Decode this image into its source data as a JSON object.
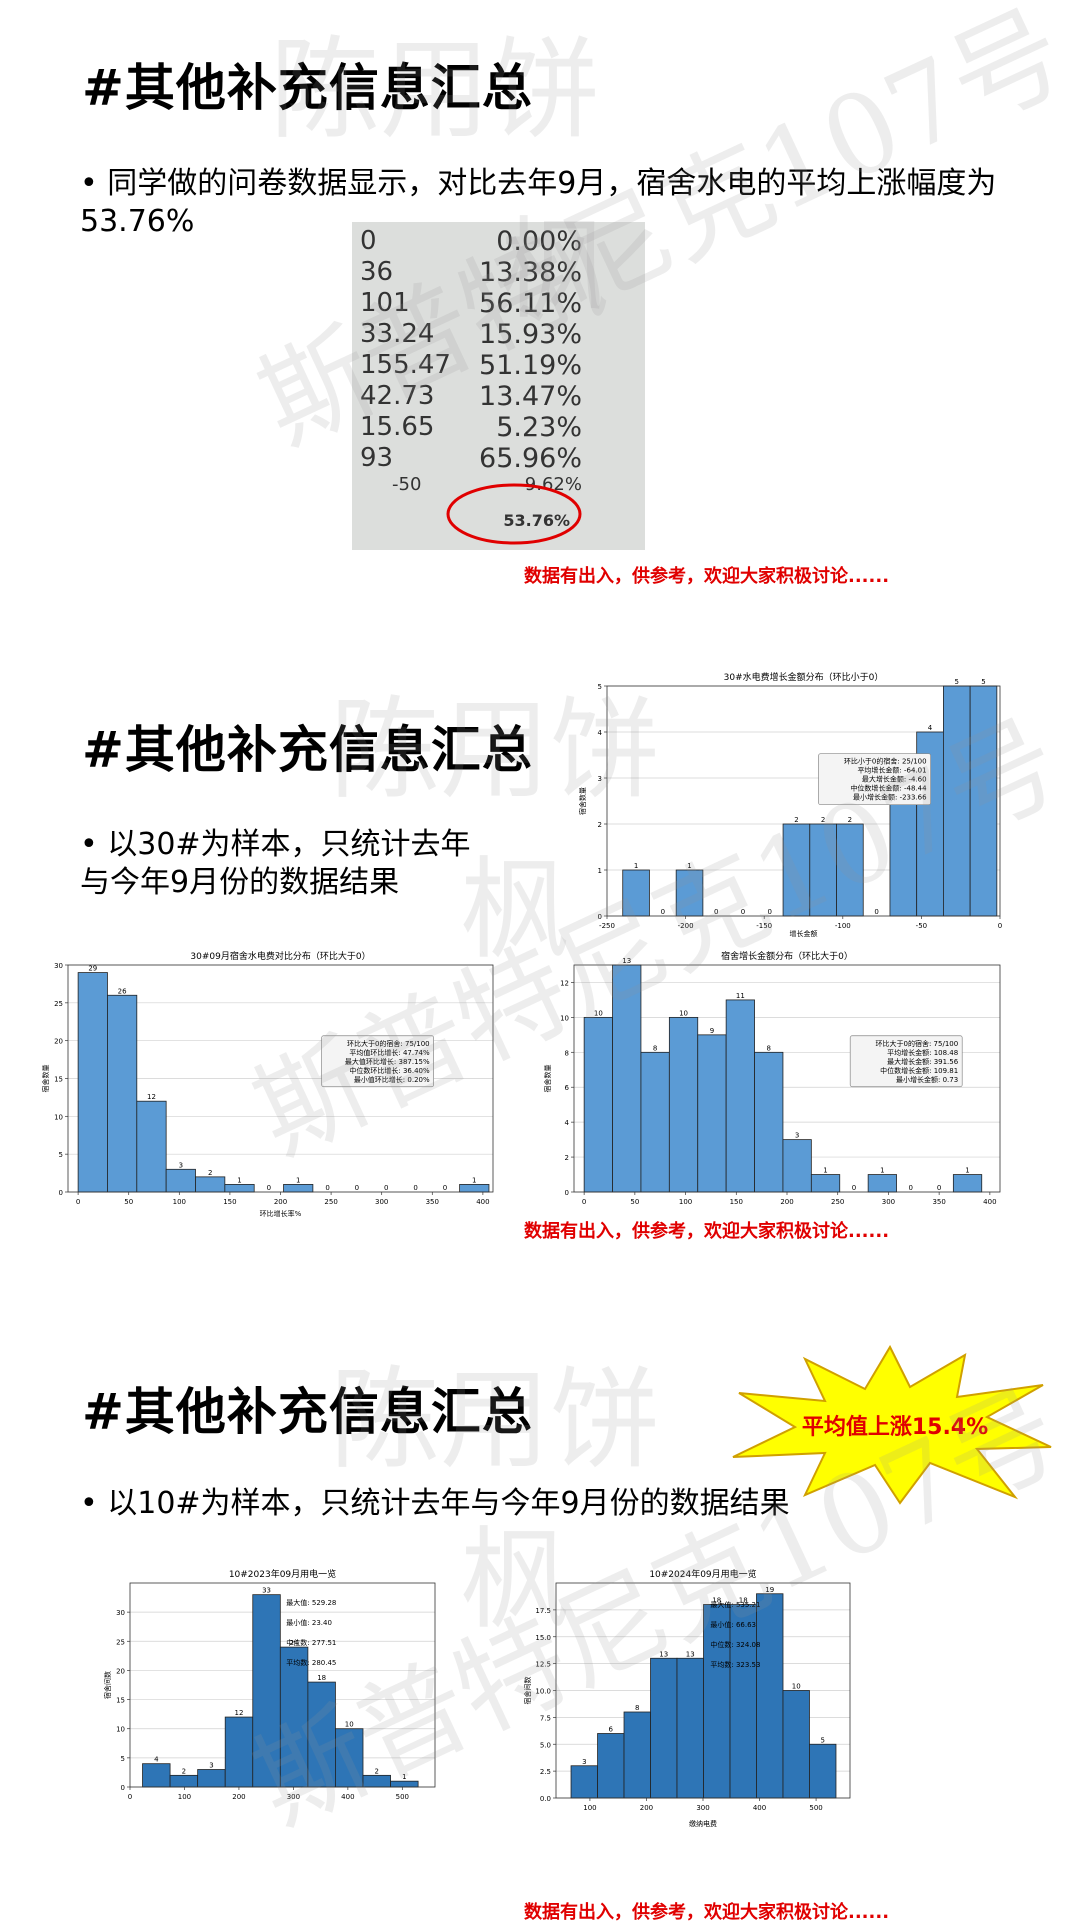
{
  "watermark": {
    "line1": "陈用饼",
    "line2": "枫",
    "line3": "斯普特尼克107号"
  },
  "section1": {
    "title": "#其他补充信息汇总",
    "bullet": "同学做的问卷数据显示，对比去年9月，宿舍水电的平均上涨幅度为53.76%",
    "table_rows": [
      {
        "a": "0",
        "b": "0.00%"
      },
      {
        "a": "36",
        "b": "13.38%"
      },
      {
        "a": "101",
        "b": "56.11%"
      },
      {
        "a": "33.24",
        "b": "15.93%"
      },
      {
        "a": "155.47",
        "b": "51.19%"
      },
      {
        "a": "42.73",
        "b": "13.47%"
      },
      {
        "a": "15.65",
        "b": "5.23%"
      },
      {
        "a": "93",
        "b": "65.96%"
      },
      {
        "a": "-50",
        "b": "-9.62%"
      },
      {
        "a": "",
        "b": "53.76%"
      }
    ],
    "note": "数据有出入，供参考，欢迎大家积极讨论......",
    "highlight_color": "#e00000"
  },
  "section2": {
    "title": "#其他补充信息汇总",
    "bullet_line1": "以30#为样本，只统计去年",
    "bullet_line2": "与今年9月份的数据结果",
    "note": "数据有出入，供参考，欢迎大家积极讨论......"
  },
  "section3": {
    "title": "#其他补充信息汇总",
    "bullet": "以10#为样本，只统计去年与今年9月份的数据结果",
    "burst_label": "平均值上涨15.4%",
    "note": "数据有出入，供参考，欢迎大家积极讨论......"
  },
  "chart_data": [
    {
      "id": "c1",
      "type": "bar",
      "title": "30#水电费增长金额分布（环比小于0）",
      "xlabel": "增长金额",
      "ylabel": "宿舍数量",
      "xlim": [
        -250,
        0
      ],
      "ylim": [
        0,
        5
      ],
      "xticks": [
        -250,
        -200,
        -150,
        -100,
        -50,
        0
      ],
      "yticks": [
        0,
        1,
        2,
        3,
        4,
        5
      ],
      "bins": [
        -240,
        -220,
        -200,
        -180,
        -160,
        -140,
        -120,
        -100,
        -80,
        -60,
        -40,
        -20,
        0
      ],
      "values": [
        1,
        0,
        1,
        0,
        0,
        0,
        2,
        2,
        2,
        0,
        3,
        4,
        5,
        5
      ],
      "edges": [
        -240,
        -223,
        -206,
        -189,
        -172,
        -155,
        -138,
        -121,
        -104,
        -87,
        -70,
        -53,
        -36,
        -19,
        -2
      ],
      "color": "#5b9bd5",
      "stats": [
        "环比小于0的宿舍: 25/100",
        "平均增长金额: -64.01",
        "最大增长金额: -4.60",
        "中位数增长金额: -48.44",
        "最小增长金额: -233.66"
      ]
    },
    {
      "id": "c2",
      "type": "bar",
      "title": "30#09月宿舍水电费对比分布（环比大于0）",
      "xlabel": "环比增长率%",
      "ylabel": "宿舍数量",
      "xlim": [
        -10,
        410
      ],
      "ylim": [
        0,
        30
      ],
      "xticks": [
        0,
        50,
        100,
        150,
        200,
        250,
        300,
        350,
        400
      ],
      "yticks": [
        0,
        5,
        10,
        15,
        20,
        25,
        30
      ],
      "edges": [
        0,
        29,
        58,
        87,
        116,
        145,
        174,
        203,
        232,
        261,
        290,
        319,
        348,
        377,
        406
      ],
      "values": [
        29,
        26,
        12,
        3,
        2,
        1,
        0,
        1,
        0,
        0,
        0,
        0,
        0,
        1
      ],
      "color": "#5b9bd5",
      "stats": [
        "环比大于0的宿舍: 75/100",
        "平均值环比增长: 47.74%",
        "最大值环比增长: 387.15%",
        "中位数环比增长: 36.40%",
        "最小值环比增长: 0.20%"
      ]
    },
    {
      "id": "c3",
      "type": "bar",
      "title": "宿舍增长金额分布（环比大于0）",
      "xlabel": "",
      "ylabel": "宿舍数量",
      "xlim": [
        -10,
        410
      ],
      "ylim": [
        0,
        13
      ],
      "xticks": [
        0,
        50,
        100,
        150,
        200,
        250,
        300,
        350,
        400
      ],
      "yticks": [
        0,
        2,
        4,
        6,
        8,
        10,
        12
      ],
      "edges": [
        0,
        28,
        56,
        84,
        112,
        140,
        168,
        196,
        224,
        252,
        280,
        308,
        336,
        364,
        392
      ],
      "values": [
        10,
        13,
        8,
        10,
        9,
        11,
        8,
        3,
        1,
        0,
        1,
        0,
        0,
        1
      ],
      "color": "#5b9bd5",
      "stats": [
        "环比大于0的宿舍: 75/100",
        "平均增长金额: 108.48",
        "最大增长金额: 391.56",
        "中位数增长金额: 109.81",
        "最小增长金额: 0.73"
      ]
    },
    {
      "id": "c4",
      "type": "bar",
      "title": "10#2023年09月用电一览",
      "xlabel": "",
      "ylabel": "宿舍间数",
      "xlim": [
        0,
        560
      ],
      "ylim": [
        0,
        35
      ],
      "xticks": [
        0,
        100,
        200,
        300,
        400,
        500
      ],
      "yticks": [
        0,
        5,
        10,
        15,
        20,
        25,
        30
      ],
      "edges": [
        23,
        73.6,
        124.2,
        174.8,
        225.4,
        276,
        326.6,
        377.2,
        427.8,
        478.4,
        529
      ],
      "values": [
        4,
        2,
        3,
        12,
        33,
        24,
        18,
        10,
        2,
        1
      ],
      "color": "#2e75b6",
      "stats": [
        "最大值: 529.28",
        "最小值: 23.40",
        "中位数: 277.51",
        "平均数: 280.45"
      ]
    },
    {
      "id": "c5",
      "type": "bar",
      "title": "10#2024年09月用电一览",
      "xlabel": "缴纳电费",
      "ylabel": "宿舍间数",
      "xlim": [
        40,
        560
      ],
      "ylim": [
        0,
        20
      ],
      "xticks": [
        100,
        200,
        300,
        400,
        500
      ],
      "yticks": [
        0,
        2.5,
        5,
        7.5,
        10,
        12.5,
        15,
        17.5
      ],
      "ytick_labels": [
        "0.0",
        "2.5",
        "5.0",
        "7.5",
        "10.0",
        "12.5",
        "15.0",
        "17.5"
      ],
      "edges": [
        66.6,
        113.5,
        160.3,
        207.2,
        254.0,
        300.9,
        347.8,
        394.6,
        441.5,
        488.3,
        535.2
      ],
      "values": [
        3,
        6,
        8,
        13,
        13,
        18,
        18,
        19,
        10,
        5
      ],
      "color": "#2e75b6",
      "stats": [
        "最大值: 535.21",
        "最小值: 66.63",
        "中位数: 324.08",
        "平均数: 323.53"
      ]
    }
  ]
}
